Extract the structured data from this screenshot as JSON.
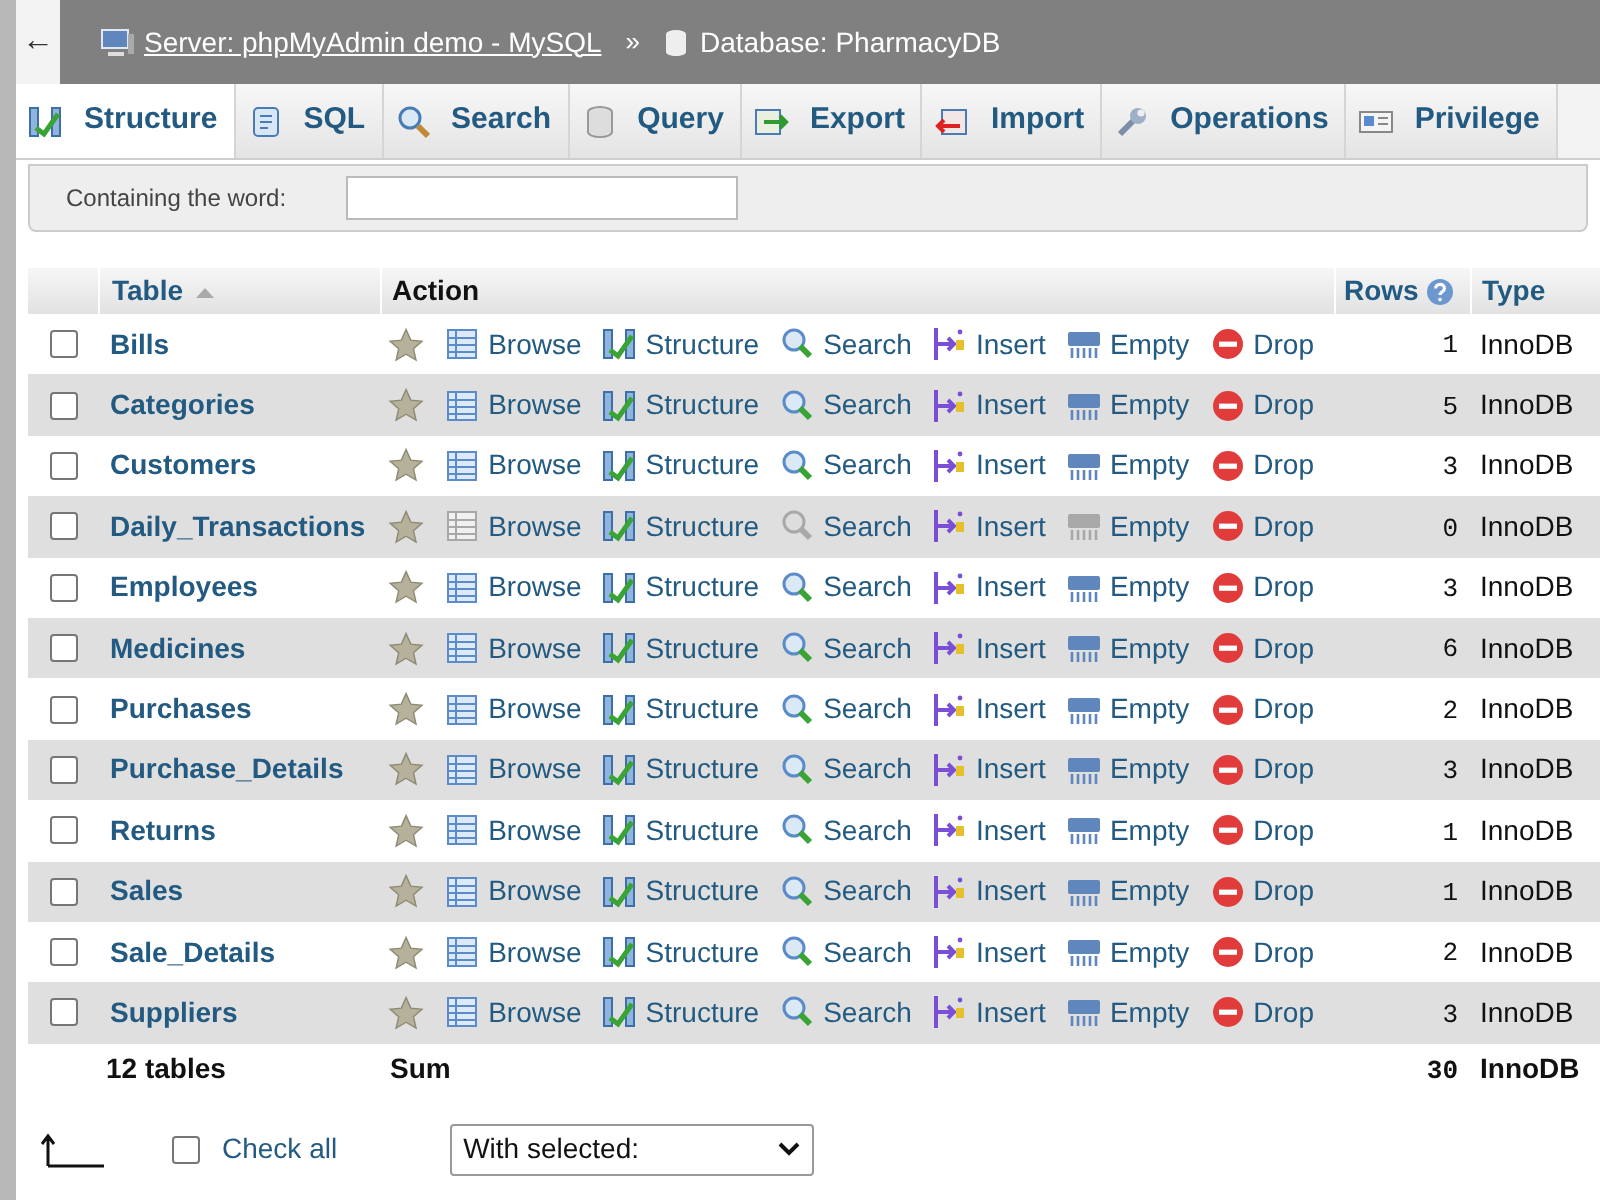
{
  "breadcrumb": {
    "back": "←",
    "server": "Server: phpMyAdmin demo - MySQL",
    "separator": "»",
    "database": "Database: PharmacyDB"
  },
  "tabs": [
    {
      "label": "Structure",
      "selected": true
    },
    {
      "label": "SQL",
      "selected": false
    },
    {
      "label": "Search",
      "selected": false
    },
    {
      "label": "Query",
      "selected": false
    },
    {
      "label": "Export",
      "selected": false
    },
    {
      "label": "Import",
      "selected": false
    },
    {
      "label": "Operations",
      "selected": false
    },
    {
      "label": "Privilege",
      "selected": false
    }
  ],
  "filter": {
    "label": "Containing the word:"
  },
  "table": {
    "columns": [
      "Table",
      "Action",
      "Rows",
      "Type"
    ],
    "rows": [
      {
        "name": "Bills",
        "checked": false,
        "empty": false,
        "actions": [
          "Browse",
          "Structure",
          "Search",
          "Insert",
          "Empty",
          "Drop"
        ],
        "rows": "1",
        "type": "InnoDB"
      },
      {
        "name": "Categories",
        "checked": false,
        "empty": false,
        "actions": [
          "Browse",
          "Structure",
          "Search",
          "Insert",
          "Empty",
          "Drop"
        ],
        "rows": "5",
        "type": "InnoDB"
      },
      {
        "name": "Customers",
        "checked": false,
        "empty": false,
        "actions": [
          "Browse",
          "Structure",
          "Search",
          "Insert",
          "Empty",
          "Drop"
        ],
        "rows": "3",
        "type": "InnoDB"
      },
      {
        "name": "Daily_Transactions",
        "checked": false,
        "empty": true,
        "actions": [
          "Browse",
          "Structure",
          "Search",
          "Insert",
          "Empty",
          "Drop"
        ],
        "rows": "0",
        "type": "InnoDB"
      },
      {
        "name": "Employees",
        "checked": false,
        "empty": false,
        "actions": [
          "Browse",
          "Structure",
          "Search",
          "Insert",
          "Empty",
          "Drop"
        ],
        "rows": "3",
        "type": "InnoDB"
      },
      {
        "name": "Medicines",
        "checked": false,
        "empty": false,
        "actions": [
          "Browse",
          "Structure",
          "Search",
          "Insert",
          "Empty",
          "Drop"
        ],
        "rows": "6",
        "type": "InnoDB"
      },
      {
        "name": "Purchases",
        "checked": false,
        "empty": false,
        "actions": [
          "Browse",
          "Structure",
          "Search",
          "Insert",
          "Empty",
          "Drop"
        ],
        "rows": "2",
        "type": "InnoDB"
      },
      {
        "name": "Purchase_Details",
        "checked": false,
        "empty": false,
        "actions": [
          "Browse",
          "Structure",
          "Search",
          "Insert",
          "Empty",
          "Drop"
        ],
        "rows": "3",
        "type": "InnoDB"
      },
      {
        "name": "Returns",
        "checked": false,
        "empty": false,
        "actions": [
          "Browse",
          "Structure",
          "Search",
          "Insert",
          "Empty",
          "Drop"
        ],
        "rows": "1",
        "type": "InnoDB"
      },
      {
        "name": "Sales",
        "checked": false,
        "empty": false,
        "actions": [
          "Browse",
          "Structure",
          "Search",
          "Insert",
          "Empty",
          "Drop"
        ],
        "rows": "1",
        "type": "InnoDB"
      },
      {
        "name": "Sale_Details",
        "checked": false,
        "empty": false,
        "actions": [
          "Browse",
          "Structure",
          "Search",
          "Insert",
          "Empty",
          "Drop"
        ],
        "rows": "2",
        "type": "InnoDB"
      },
      {
        "name": "Suppliers",
        "checked": false,
        "empty": false,
        "actions": [
          "Browse",
          "Structure",
          "Search",
          "Insert",
          "Empty",
          "Drop"
        ],
        "rows": "3",
        "type": "InnoDB"
      }
    ],
    "summary": {
      "tables": "12 tables",
      "label": "Sum",
      "rows": "30",
      "type": "InnoDB"
    }
  },
  "footer": {
    "check_all": "Check all",
    "checked": false,
    "with_selected": "With selected:"
  }
}
